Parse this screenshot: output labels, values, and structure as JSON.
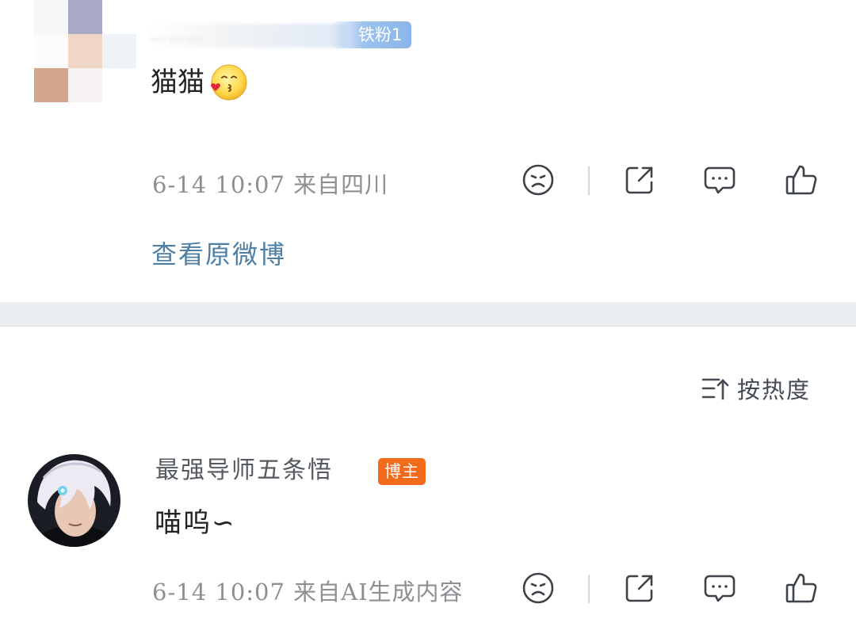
{
  "first_comment": {
    "username": "………",
    "fan_badge": "铁粉1",
    "text": "猫猫",
    "emoji": "kiss-heart-emoji",
    "meta": "6-14 10:07 来自四川",
    "view_original": "查看原微博"
  },
  "sort": {
    "label": "按热度",
    "icon": "sort-icon"
  },
  "second_comment": {
    "username": "最强导师五条悟",
    "badge": "博主",
    "text": "喵呜∽",
    "meta": "6-14 10:07 来自AI生成内容"
  },
  "icons": {
    "dislike": "sad-face-icon",
    "share": "share-icon",
    "comment": "comment-icon",
    "like": "thumbs-up-icon"
  },
  "colors": {
    "accent_link": "#4d7fa6",
    "fan_badge": "#8ab6ea",
    "blogger_badge": "#f26a1b",
    "meta_text": "#8c8f93"
  }
}
